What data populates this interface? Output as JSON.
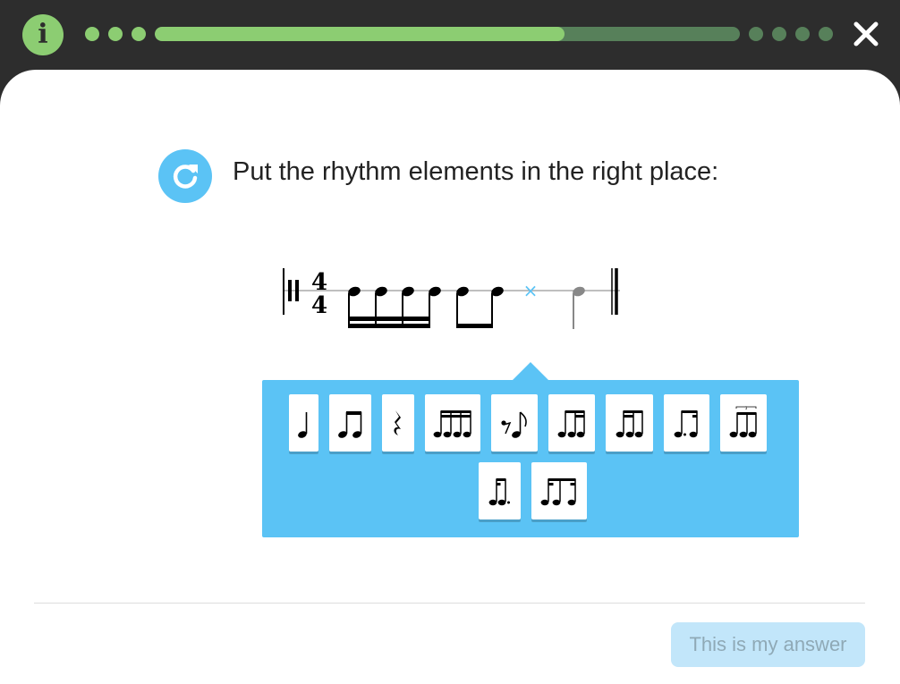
{
  "header": {
    "info_icon": "info-icon",
    "info_glyph": "i",
    "progress": {
      "filled_fraction": 0.7,
      "steps_done": 3,
      "steps_remaining": 4
    },
    "close_icon": "close-icon",
    "colors": {
      "done": "#8ccd72",
      "remaining": "#57805a",
      "bar_bg": "#2d2d2d"
    }
  },
  "question": {
    "reload_icon": "reload-icon",
    "text": "Put the rhythm elements in the right place:"
  },
  "staff": {
    "time_signature": {
      "top": "4",
      "bottom": "4"
    },
    "elements": [
      "sixteenth-note-group",
      "eighth-note-pair",
      "empty-slot",
      "quarter-note"
    ],
    "slot_marker": "×"
  },
  "palette": {
    "tiles": [
      {
        "name": "quarter-note-tile",
        "icon": "quarter-note-icon"
      },
      {
        "name": "two-eighth-notes-tile",
        "icon": "two-eighth-notes-icon"
      },
      {
        "name": "quarter-rest-tile",
        "icon": "quarter-rest-icon"
      },
      {
        "name": "four-sixteenth-notes-tile",
        "icon": "four-sixteenth-notes-icon"
      },
      {
        "name": "eighth-rest-eighth-note-tile",
        "icon": "eighth-rest-eighth-note-icon"
      },
      {
        "name": "eighth-two-sixteenths-tile",
        "icon": "eighth-two-sixteenths-icon"
      },
      {
        "name": "two-sixteenths-eighth-tile",
        "icon": "two-sixteenths-eighth-icon"
      },
      {
        "name": "dotted-eighth-sixteenth-tile",
        "icon": "dotted-eighth-sixteenth-icon"
      },
      {
        "name": "triplet-tile",
        "icon": "triplet-icon"
      },
      {
        "name": "sixteenth-dotted-eighth-tile",
        "icon": "sixteenth-dotted-eighth-icon"
      },
      {
        "name": "syncopated-tile",
        "icon": "syncopated-icon"
      }
    ]
  },
  "footer": {
    "answer_label": "This is my answer",
    "answer_enabled": false
  },
  "colors": {
    "accent": "#5bc3f5",
    "answer_disabled_bg": "#c2e6fa",
    "answer_disabled_text": "#8fa9b6"
  }
}
